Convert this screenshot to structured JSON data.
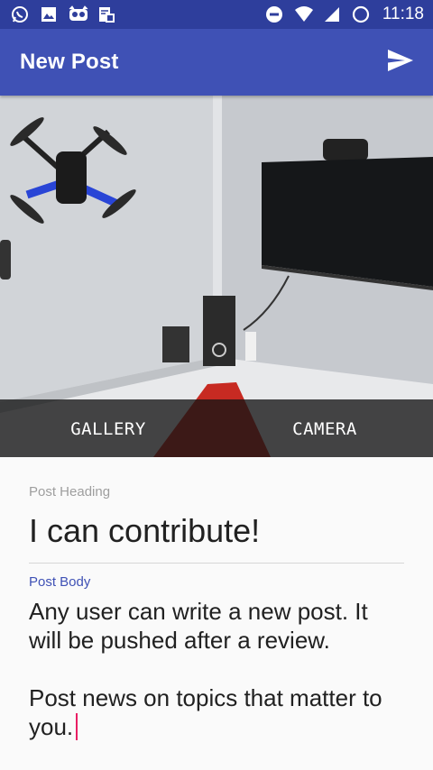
{
  "status_bar": {
    "time": "11:18",
    "left_icons": [
      "whatsapp-icon",
      "image-icon",
      "owl-icon",
      "sim-icon"
    ],
    "right_icons": [
      "do-not-disturb-icon",
      "wifi-icon",
      "signal-icon",
      "battery-icon"
    ]
  },
  "app_bar": {
    "title": "New Post",
    "send_icon": "send-icon"
  },
  "photo": {
    "gallery_label": "GALLERY",
    "camera_label": "CAMERA"
  },
  "form": {
    "heading_label": "Post Heading",
    "heading_value": "I can contribute!",
    "body_label": "Post Body",
    "body_value": "Any user can write a new post. It will be pushed after a review.\n\nPost news on topics that matter to you."
  },
  "colors": {
    "primary": "#3f51b5",
    "primary_dark": "#2e3e9c",
    "accent": "#e91e63"
  }
}
